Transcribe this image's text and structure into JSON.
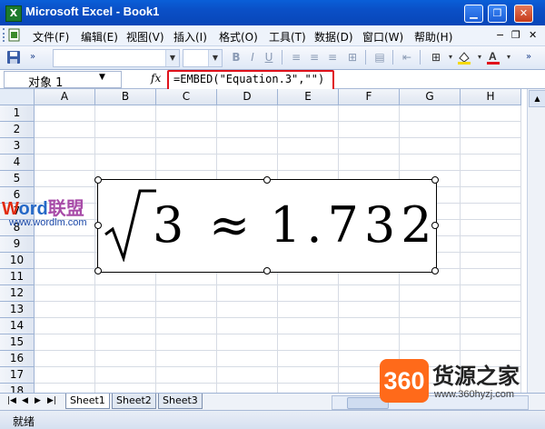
{
  "window": {
    "title": "Microsoft Excel - Book1",
    "app_icon": "excel-icon",
    "controls": [
      "minimize-icon",
      "restore-icon",
      "close-icon"
    ]
  },
  "menu": {
    "items": [
      "文件(F)",
      "编辑(E)",
      "视图(V)",
      "插入(I)",
      "格式(O)",
      "工具(T)",
      "数据(D)",
      "窗口(W)",
      "帮助(H)"
    ]
  },
  "formula_bar": {
    "name_box": "对象 1",
    "fx_label": "fx",
    "formula": "=EMBED(\"Equation.3\",\"\")"
  },
  "grid": {
    "columns": [
      "A",
      "B",
      "C",
      "D",
      "E",
      "F",
      "G",
      "H"
    ],
    "rows": [
      "1",
      "2",
      "3",
      "4",
      "5",
      "6",
      "7",
      "8",
      "9",
      "10",
      "11",
      "12",
      "13",
      "14",
      "15",
      "16",
      "17",
      "18"
    ]
  },
  "equation": {
    "radicand": "3",
    "approx_symbol": "≈",
    "value": "1.732"
  },
  "watermark": {
    "word_w": "W",
    "word_ord": "ord",
    "word_cn": "联盟",
    "url": "www.wordlm.com"
  },
  "sheets": {
    "tabs": [
      "Sheet1",
      "Sheet2",
      "Sheet3"
    ],
    "active": "Sheet1"
  },
  "status": {
    "text": "就绪"
  },
  "logo": {
    "number": "360",
    "name": "货源之家",
    "url": "www.360hyzj.com"
  }
}
